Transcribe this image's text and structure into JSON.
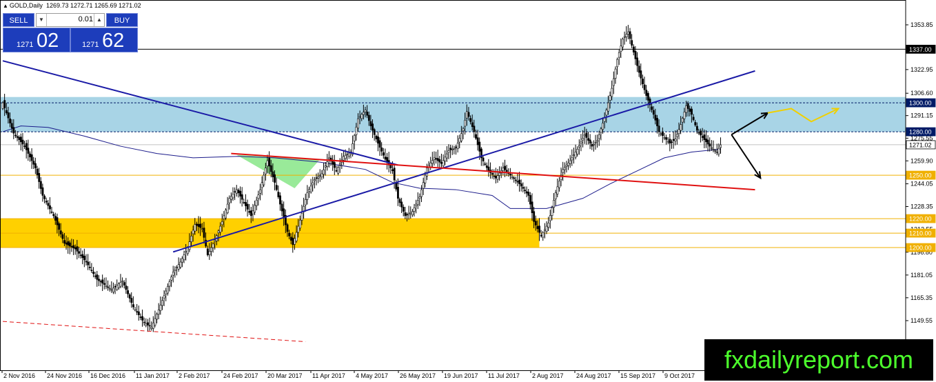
{
  "header": {
    "triangle_icon": "triangle-up-icon",
    "symbol": "GOLD,Daily",
    "ohlc": "1269.73 1272.71 1265.69 1271.02"
  },
  "trade_panel": {
    "sell_label": "SELL",
    "buy_label": "BUY",
    "lot": "0.01",
    "sell_small": "1271",
    "sell_big": "02",
    "buy_small": "1271",
    "buy_big": "62",
    "colors": {
      "panel": "#1d3dbb",
      "text": "#ffffff"
    }
  },
  "watermark": "fxdailyreport.com",
  "chart_data": {
    "type": "candlestick",
    "symbol": "GOLD",
    "timeframe": "Daily",
    "ylim": [
      1135,
      1364
    ],
    "x_tick_labels": [
      "2 Nov 2016",
      "24 Nov 2016",
      "16 Dec 2016",
      "11 Jan 2017",
      "2 Feb 2017",
      "24 Feb 2017",
      "20 Mar 2017",
      "11 Apr 2017",
      "4 May 2017",
      "26 May 2017",
      "19 Jun 2017",
      "11 Jul 2017",
      "2 Aug 2017",
      "24 Aug 2017",
      "15 Sep 2017",
      "9 Oct 2017"
    ],
    "y_tick_labels": [
      1353.85,
      1322.95,
      1306.6,
      1291.15,
      1275.55,
      1259.9,
      1244.05,
      1228.35,
      1212.55,
      1196.8,
      1181.05,
      1165.35,
      1149.55
    ],
    "price_tags": [
      {
        "label": "1337.00",
        "style": "black"
      },
      {
        "label": "1300.00",
        "style": "navy"
      },
      {
        "label": "1280.00",
        "style": "navy"
      },
      {
        "label": "1271.02",
        "style": "current"
      },
      {
        "label": "1250.00",
        "style": "orange"
      },
      {
        "label": "1220.00",
        "style": "orange"
      },
      {
        "label": "1210.00",
        "style": "orange"
      },
      {
        "label": "1200.00",
        "style": "orange"
      }
    ],
    "close_path": [
      [
        0,
        1300
      ],
      [
        6,
        1279
      ],
      [
        12,
        1270
      ],
      [
        18,
        1255
      ],
      [
        22,
        1236
      ],
      [
        28,
        1222
      ],
      [
        34,
        1203
      ],
      [
        40,
        1199
      ],
      [
        46,
        1190
      ],
      [
        52,
        1178
      ],
      [
        60,
        1171
      ],
      [
        66,
        1177
      ],
      [
        72,
        1159
      ],
      [
        78,
        1148
      ],
      [
        82,
        1145
      ],
      [
        86,
        1157
      ],
      [
        90,
        1170
      ],
      [
        94,
        1183
      ],
      [
        98,
        1190
      ],
      [
        102,
        1200
      ],
      [
        106,
        1216
      ],
      [
        110,
        1213
      ],
      [
        113,
        1195
      ],
      [
        117,
        1205
      ],
      [
        121,
        1218
      ],
      [
        125,
        1234
      ],
      [
        129,
        1240
      ],
      [
        133,
        1231
      ],
      [
        137,
        1222
      ],
      [
        142,
        1240
      ],
      [
        146,
        1260
      ],
      [
        150,
        1245
      ],
      [
        153,
        1230
      ],
      [
        157,
        1211
      ],
      [
        160,
        1202
      ],
      [
        164,
        1219
      ],
      [
        168,
        1238
      ],
      [
        172,
        1247
      ],
      [
        176,
        1251
      ],
      [
        180,
        1262
      ],
      [
        184,
        1253
      ],
      [
        188,
        1263
      ],
      [
        192,
        1266
      ],
      [
        196,
        1289
      ],
      [
        200,
        1295
      ],
      [
        203,
        1284
      ],
      [
        207,
        1272
      ],
      [
        211,
        1261
      ],
      [
        215,
        1253
      ],
      [
        218,
        1234
      ],
      [
        222,
        1222
      ],
      [
        226,
        1225
      ],
      [
        230,
        1235
      ],
      [
        234,
        1255
      ],
      [
        238,
        1262
      ],
      [
        242,
        1258
      ],
      [
        246,
        1267
      ],
      [
        250,
        1269
      ],
      [
        254,
        1282
      ],
      [
        256,
        1294
      ],
      [
        260,
        1280
      ],
      [
        264,
        1262
      ],
      [
        268,
        1253
      ],
      [
        272,
        1248
      ],
      [
        276,
        1255
      ],
      [
        280,
        1250
      ],
      [
        285,
        1244
      ],
      [
        290,
        1236
      ],
      [
        293,
        1218
      ],
      [
        297,
        1208
      ],
      [
        301,
        1217
      ],
      [
        305,
        1238
      ],
      [
        309,
        1254
      ],
      [
        313,
        1260
      ],
      [
        317,
        1268
      ],
      [
        321,
        1278
      ],
      [
        325,
        1270
      ],
      [
        328,
        1274
      ],
      [
        332,
        1290
      ],
      [
        336,
        1310
      ],
      [
        339,
        1330
      ],
      [
        342,
        1344
      ],
      [
        345,
        1349
      ],
      [
        348,
        1335
      ],
      [
        351,
        1321
      ],
      [
        355,
        1305
      ],
      [
        359,
        1292
      ],
      [
        362,
        1280
      ],
      [
        365,
        1276
      ],
      [
        368,
        1272
      ],
      [
        371,
        1275
      ],
      [
        374,
        1285
      ],
      [
        377,
        1298
      ],
      [
        380,
        1292
      ],
      [
        383,
        1281
      ],
      [
        386,
        1276
      ],
      [
        390,
        1270
      ],
      [
        394,
        1266
      ],
      [
        396,
        1271
      ]
    ],
    "moving_average": [
      [
        0,
        1280
      ],
      [
        10,
        1284
      ],
      [
        25,
        1283
      ],
      [
        45,
        1277
      ],
      [
        65,
        1270
      ],
      [
        85,
        1265
      ],
      [
        105,
        1262
      ],
      [
        130,
        1263
      ],
      [
        150,
        1262
      ],
      [
        175,
        1259
      ],
      [
        200,
        1254
      ],
      [
        215,
        1245
      ],
      [
        230,
        1241
      ],
      [
        250,
        1240
      ],
      [
        270,
        1236
      ],
      [
        280,
        1227
      ],
      [
        300,
        1227
      ],
      [
        320,
        1234
      ],
      [
        335,
        1244
      ],
      [
        350,
        1253
      ],
      [
        365,
        1262
      ],
      [
        380,
        1266
      ],
      [
        396,
        1268
      ]
    ],
    "zones": [
      {
        "name": "resistance-zone",
        "from": 1280,
        "to": 1304,
        "color": "#a8d4e6"
      },
      {
        "name": "support-zone",
        "from": 1200,
        "to": 1220,
        "color": "#ffd000"
      }
    ],
    "horizontal_levels": [
      {
        "price": 1337,
        "color": "#000000",
        "style": "solid"
      },
      {
        "price": 1300,
        "color": "#001a66",
        "style": "dashed"
      },
      {
        "price": 1280,
        "color": "#001a66",
        "style": "dashed"
      },
      {
        "price": 1271.02,
        "color": "#c0c0c0",
        "style": "solid"
      },
      {
        "price": 1250,
        "color": "#f0b000",
        "style": "solid"
      },
      {
        "price": 1220,
        "color": "#f0b000",
        "style": "solid"
      },
      {
        "price": 1210,
        "color": "#f0b000",
        "style": "solid"
      },
      {
        "price": 1200,
        "color": "#f0b000",
        "style": "solid"
      }
    ],
    "trendlines": [
      {
        "name": "blue-downtrend",
        "from": [
          0,
          1329
        ],
        "to": [
          218,
          1257
        ],
        "color": "#1a1aa6"
      },
      {
        "name": "blue-uptrend",
        "from": [
          94,
          1197
        ],
        "to": [
          415,
          1322
        ],
        "color": "#1a1aa6"
      },
      {
        "name": "red-trendline",
        "from": [
          126,
          1265
        ],
        "to": [
          415,
          1240
        ],
        "color": "#e01010"
      },
      {
        "name": "red-dashed-channel",
        "from": [
          0,
          1149
        ],
        "to": [
          167,
          1135
        ],
        "color": "#e01010"
      }
    ],
    "green_triangle": {
      "points": [
        [
          129,
          1264
        ],
        [
          161,
          1241
        ],
        [
          175,
          1261
        ]
      ],
      "color": "#8ee88e"
    },
    "arrows": [
      {
        "color": "#000000",
        "points": [
          [
            402,
            1278
          ],
          [
            422,
            1293
          ]
        ]
      },
      {
        "color": "#000000",
        "points": [
          [
            402,
            1278
          ],
          [
            418,
            1248
          ]
        ]
      },
      {
        "color": "#f0d000",
        "points": [
          [
            422,
            1293
          ],
          [
            435,
            1296
          ],
          [
            446,
            1287
          ],
          [
            461,
            1296
          ]
        ]
      }
    ],
    "colors": {
      "bull": "#000000",
      "bear": "#000000",
      "background": "#ffffff",
      "axis": "#000000"
    }
  }
}
